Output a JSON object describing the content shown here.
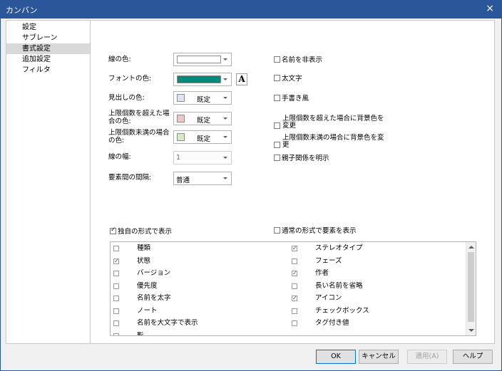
{
  "window": {
    "title": "カンバン",
    "close_glyph": "×"
  },
  "sidebar": {
    "items": [
      {
        "label": "設定"
      },
      {
        "label": "サブレーン"
      },
      {
        "label": "書式設定",
        "selected": true
      },
      {
        "label": "追加設定"
      },
      {
        "label": "フィルタ"
      }
    ]
  },
  "format": {
    "line_color": {
      "label": "線の色:",
      "swatch": "#ffffff"
    },
    "font_color": {
      "label": "フォントの色:",
      "swatch": "#008b7a",
      "font_button": "A"
    },
    "heading_color": {
      "label": "見出しの色:",
      "swatch": "#dde4f4",
      "value": "既定"
    },
    "over_limit_color": {
      "label": "上限個数を超えた場合の色:",
      "swatch": "#efc9c1",
      "value": "既定"
    },
    "under_limit_color": {
      "label": "上限個数未満の場合の色:",
      "swatch": "#d3ebc6",
      "value": "既定"
    },
    "line_width": {
      "label": "線の幅:",
      "value": "1"
    },
    "spacing": {
      "label": "要素間の間隔:",
      "value": "普通"
    }
  },
  "options": {
    "hide_name": {
      "label": "名前を非表示",
      "checked": false
    },
    "bold": {
      "label": "太文字",
      "checked": false
    },
    "handwriting": {
      "label": "手書き風",
      "checked": false
    },
    "bg_over": {
      "label": "上限個数を超えた場合に背景色を変更",
      "checked": false
    },
    "bg_under": {
      "label": "上限個数未満の場合に背景色を変更",
      "checked": false
    },
    "show_parent": {
      "label": "親子関係を明示",
      "checked": false
    }
  },
  "display": {
    "custom_format": {
      "label": "独自の形式で表示",
      "checked": true
    },
    "normal_format": {
      "label": "通常の形式で要素を表示",
      "checked": false
    }
  },
  "list": {
    "left": [
      {
        "label": "種類",
        "checked": false
      },
      {
        "label": "状態",
        "checked": true
      },
      {
        "label": "バージョン",
        "checked": false
      },
      {
        "label": "優先度",
        "checked": false
      },
      {
        "label": "名前を太字",
        "checked": false
      },
      {
        "label": "ノート",
        "checked": false
      },
      {
        "label": "名前を大文字で表示",
        "checked": false
      },
      {
        "label": "影",
        "checked": false
      }
    ],
    "right": [
      {
        "label": "ステレオタイプ",
        "checked": true
      },
      {
        "label": "フェーズ",
        "checked": false
      },
      {
        "label": "作者",
        "checked": true
      },
      {
        "label": "長い名前を省略",
        "checked": false
      },
      {
        "label": "アイコン",
        "checked": true
      },
      {
        "label": "チェックボックス",
        "checked": false
      },
      {
        "label": "タグ付き値",
        "checked": false
      }
    ]
  },
  "buttons": {
    "ok": "OK",
    "cancel": "キャンセル",
    "apply": "適用(A)",
    "help": "ヘルプ"
  }
}
